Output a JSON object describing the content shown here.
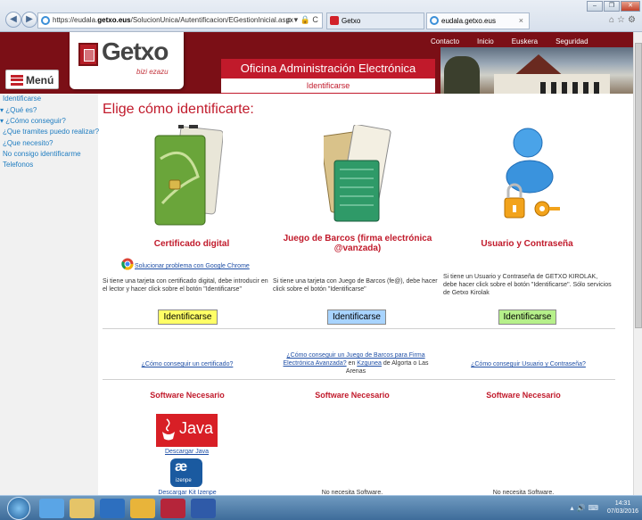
{
  "browser": {
    "url_prefix": "https://eudala.",
    "url_host": "getxo.eus",
    "url_path": "/SolucionUnica/Autentificacion/EGestionInicial.aspx",
    "addr_tools": "ρ ▾ 🔒 C",
    "tabs": [
      {
        "label": "Getxo"
      },
      {
        "label": "eudala.getxo.eus",
        "close": "×"
      }
    ]
  },
  "header": {
    "logo_text": "Getxo",
    "logo_sub": "bizi ezazu",
    "menu_label": "Menú",
    "office_title": "Oficina Administración Electrónica",
    "office_sub": "Identificarse",
    "nav": [
      "Contacto",
      "Inicio",
      "Euskera",
      "Seguridad"
    ]
  },
  "sidebar": {
    "items": [
      {
        "label": "Identificarse"
      },
      {
        "label": "▾ ¿Qué es?"
      },
      {
        "label": "▾ ¿Cómo conseguir?"
      },
      {
        "label": "¿Que tramites puedo realizar?"
      },
      {
        "label": "¿Que necesito?"
      },
      {
        "label": "No consigo identificarme"
      },
      {
        "label": "Telefonos"
      }
    ]
  },
  "main": {
    "title": "Elige cómo identificarte:",
    "cards": [
      {
        "title": "Certificado digital",
        "chrome_link": "Solucionar problema con Google Chrome",
        "desc": "Si tiene una tarjeta con certificado digital, debe introducir en el lector y hacer click sobre el botón \"Identificarse\"",
        "button": "Identificarse",
        "how": "¿Cómo conseguir un certificado?",
        "software_title": "Software Necesario",
        "software_link_java": "Descargar Java",
        "software_link_izenpe": "Descargar Kit Izenpe"
      },
      {
        "title": "Juego de Barcos (firma electrónica @vanzada)",
        "desc": "Si tiene una tarjeta con Juego de Barcos (fe@), debe hacer click sobre el botón \"Identificarse\"",
        "button": "Identificarse",
        "how_link": "¿Cómo conseguir un Juego de Barcos para Firma Electrónica Avanzada?",
        "how_en": " en ",
        "how_kzgunea": "Kzgunea",
        "how_rest": " de Algorta o Las Arenas",
        "software_title": "Software Necesario",
        "no_software": "No necesita Software."
      },
      {
        "title": "Usuario y Contraseña",
        "desc": "Si tiene un Usuario y Contraseña de GETXO KIROLAK, debe hacer click sobre el botón \"Identificarse\". Sólo servicios de Getxo Kirolak",
        "button": "Identificarse",
        "how": "¿Cómo conseguir Usuario y Contraseña?",
        "software_title": "Software Necesario",
        "no_software": "No necesita Software."
      }
    ],
    "java_logo_text": "Java",
    "izenpe_logo_text": "izenpe"
  },
  "taskbar": {
    "time": "14:31",
    "date": "07/03/2016"
  },
  "colors": {
    "brand_red": "#c11a2b",
    "header_dark": "#7b0f16",
    "btn_yellow": "#ffff66",
    "btn_blue": "#a8d4ff",
    "btn_green": "#b6f08a"
  }
}
